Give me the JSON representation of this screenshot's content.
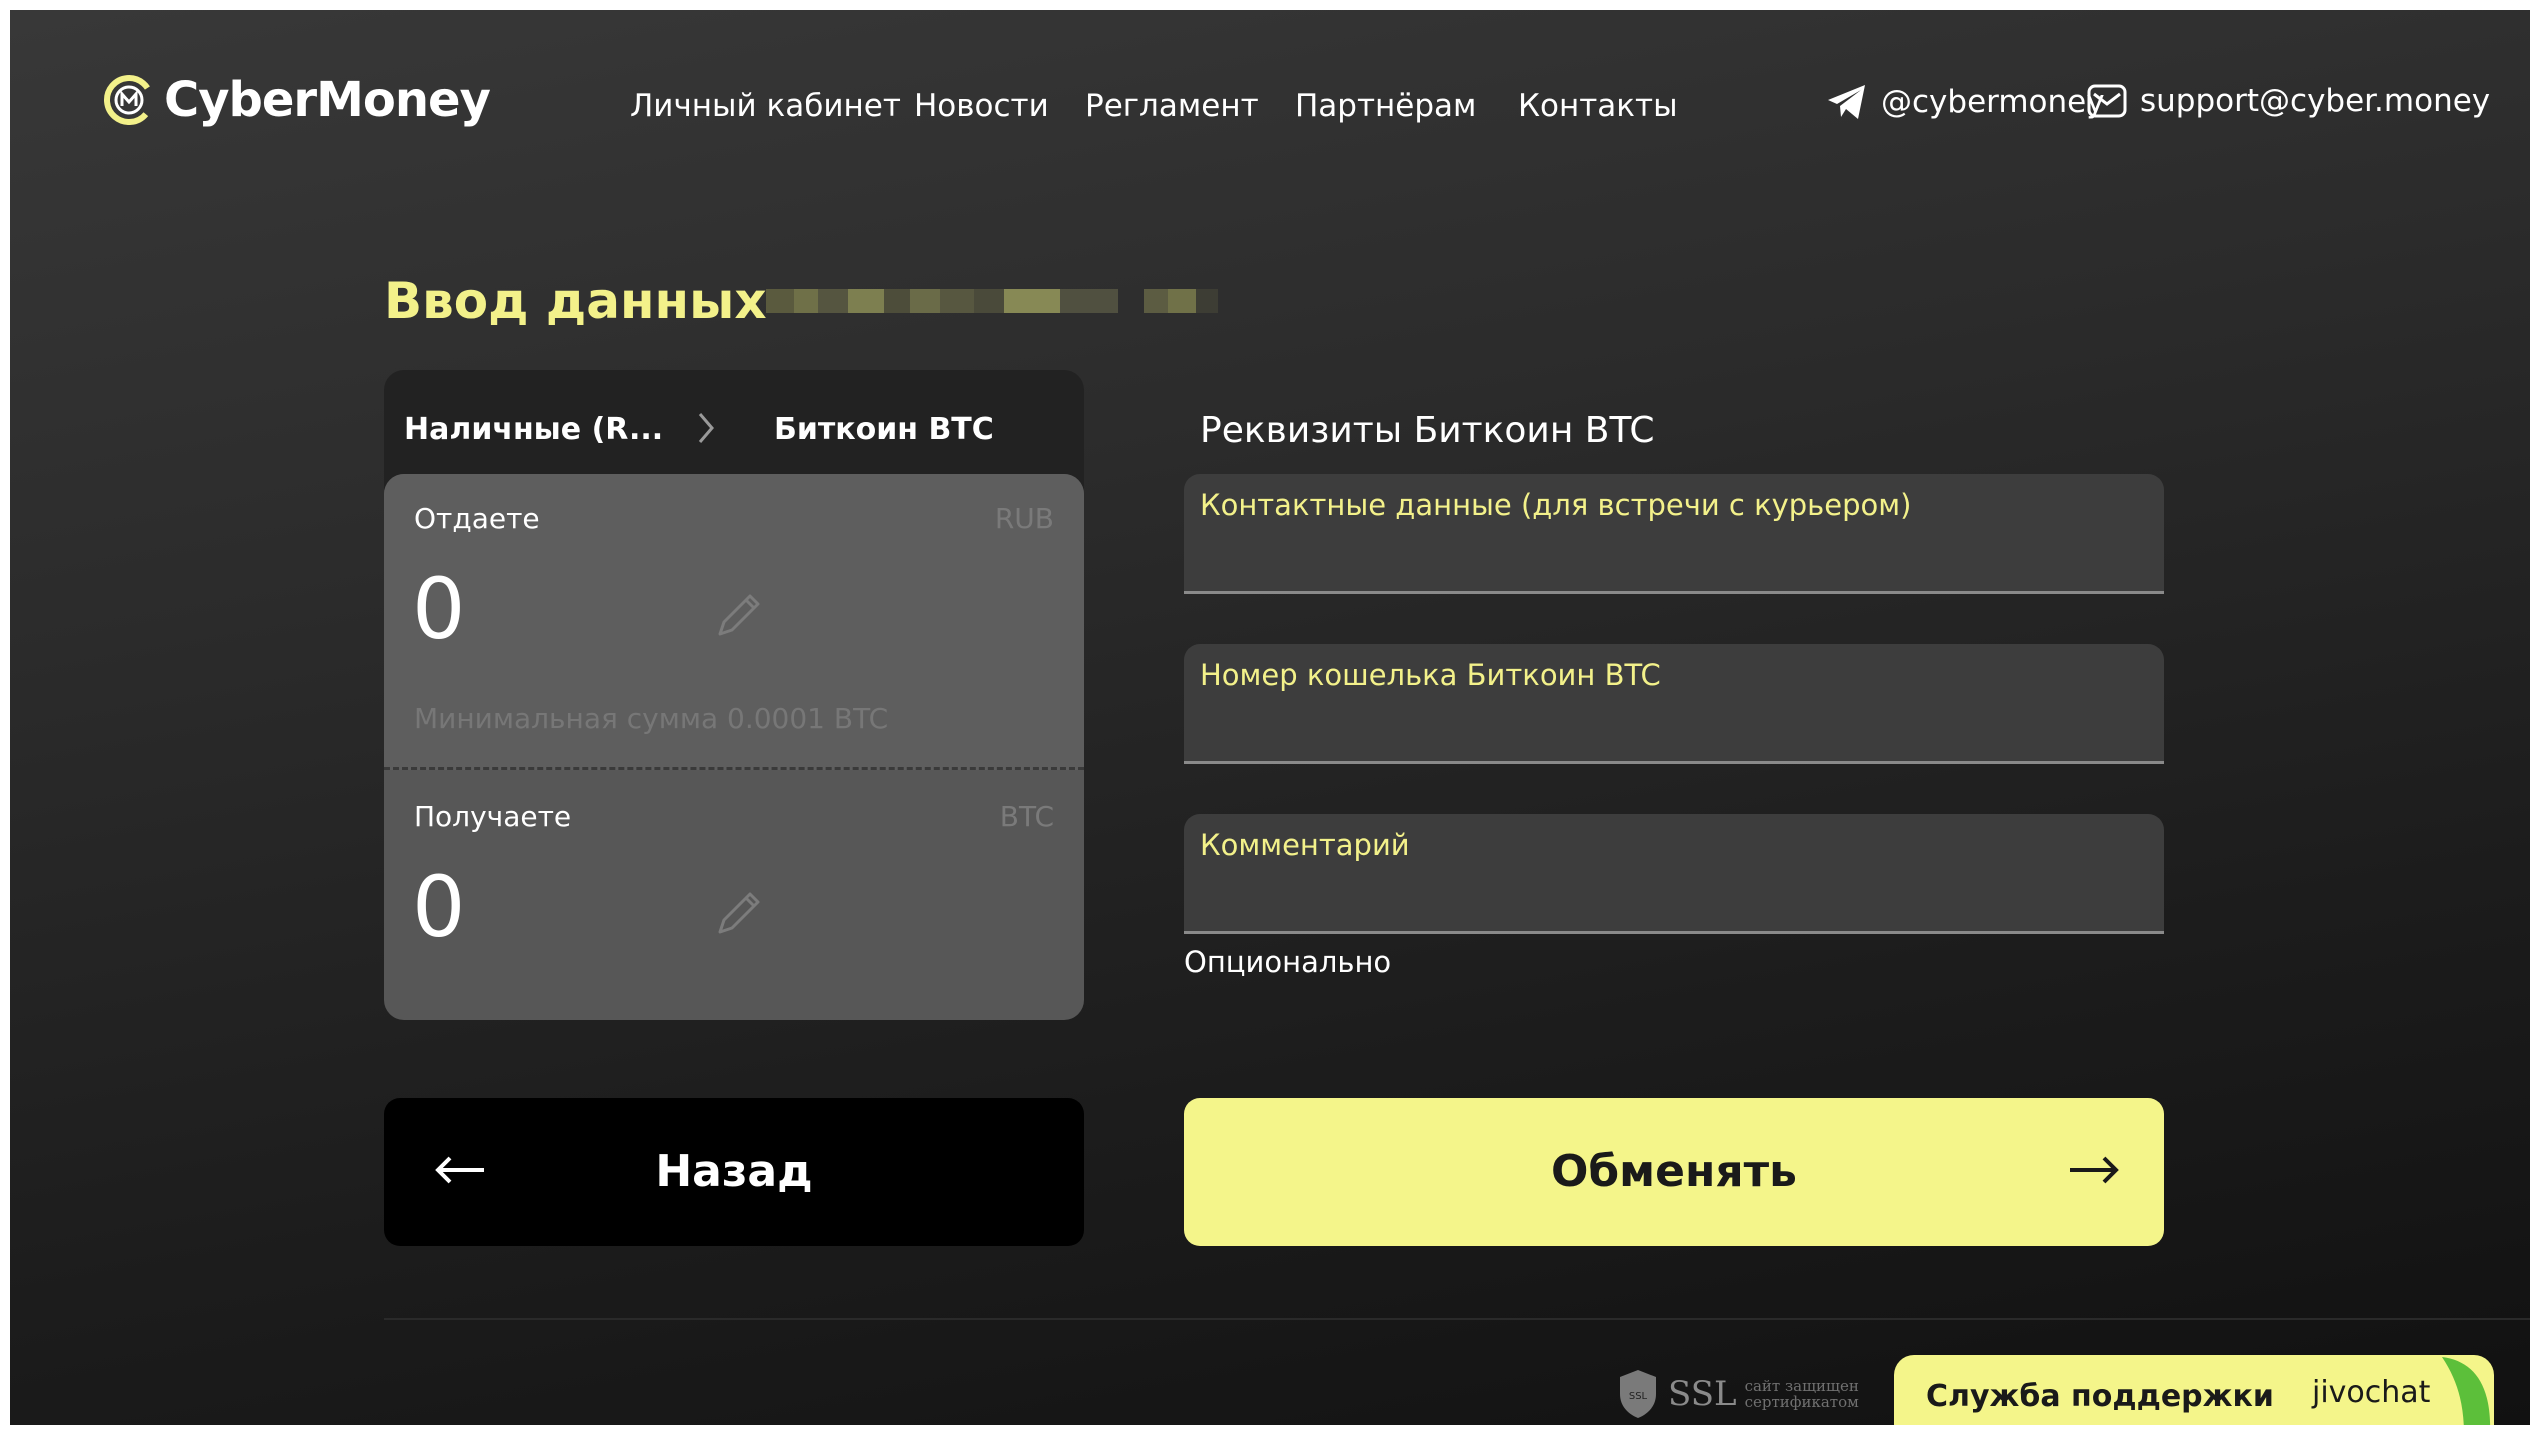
{
  "header": {
    "logo_text": "CyberMoney",
    "nav": [
      "Личный кабинет",
      "Новости",
      "Регламент",
      "Партнёрам",
      "Контакты"
    ],
    "telegram": "@cybermoney",
    "email": "support@cyber.money"
  },
  "page": {
    "title": "Ввод данных"
  },
  "exchange": {
    "from_currency": "Наличные (R...",
    "to_currency": "Биткоин BTC",
    "give_label": "Отдаете",
    "give_currency": "RUB",
    "give_amount": "0",
    "min_amount_hint": "Минимальная сумма 0.0001 BTC",
    "receive_label": "Получаете",
    "receive_currency": "BTC",
    "receive_amount": "0"
  },
  "form": {
    "title": "Реквизиты Биткоин BTC",
    "contact_label": "Контактные данные (для встречи с курьером)",
    "wallet_label": "Номер кошелька Биткоин BTC",
    "comment_label": "Комментарий",
    "comment_hint": "Опционально"
  },
  "buttons": {
    "back": "Назад",
    "exchange": "Обменять"
  },
  "footer": {
    "ssl_text": "SSL",
    "ssl_badge": "SSL",
    "ssl_sub_1": "сайт защищен",
    "ssl_sub_2": "сертификатом",
    "support_label": "Служба поддержки",
    "support_brand": "jivochat"
  },
  "colors": {
    "accent": "#f4f58a",
    "label_yellow": "#f3f18a",
    "background": "#2b2b2b"
  }
}
